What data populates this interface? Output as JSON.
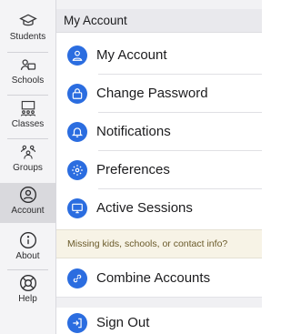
{
  "sidebar": {
    "items": [
      {
        "label": "Students",
        "icon": "graduation-cap-icon",
        "active": false
      },
      {
        "label": "Schools",
        "icon": "school-icon",
        "active": false
      },
      {
        "label": "Classes",
        "icon": "classroom-icon",
        "active": false
      },
      {
        "label": "Groups",
        "icon": "group-icon",
        "active": false
      },
      {
        "label": "Account",
        "icon": "account-icon",
        "active": true
      },
      {
        "label": "About",
        "icon": "info-icon",
        "active": false
      },
      {
        "label": "Help",
        "icon": "lifebuoy-icon",
        "active": false
      }
    ]
  },
  "header": {
    "title": "My Account"
  },
  "menu": {
    "items": [
      {
        "label": "My Account",
        "icon": "user-icon"
      },
      {
        "label": "Change Password",
        "icon": "lock-icon"
      },
      {
        "label": "Notifications",
        "icon": "bell-icon"
      },
      {
        "label": "Preferences",
        "icon": "gear-icon"
      },
      {
        "label": "Active Sessions",
        "icon": "monitor-icon"
      }
    ],
    "notice": "Missing kids, schools, or contact info?",
    "combine": {
      "label": "Combine Accounts",
      "icon": "link-icon"
    },
    "signout": {
      "label": "Sign Out",
      "icon": "sign-out-icon"
    }
  },
  "colors": {
    "accent": "#2b6de0",
    "sidebar_bg": "#f4f4f6",
    "active_bg": "#d9d9dd",
    "notice_text": "#6a5a2a"
  }
}
